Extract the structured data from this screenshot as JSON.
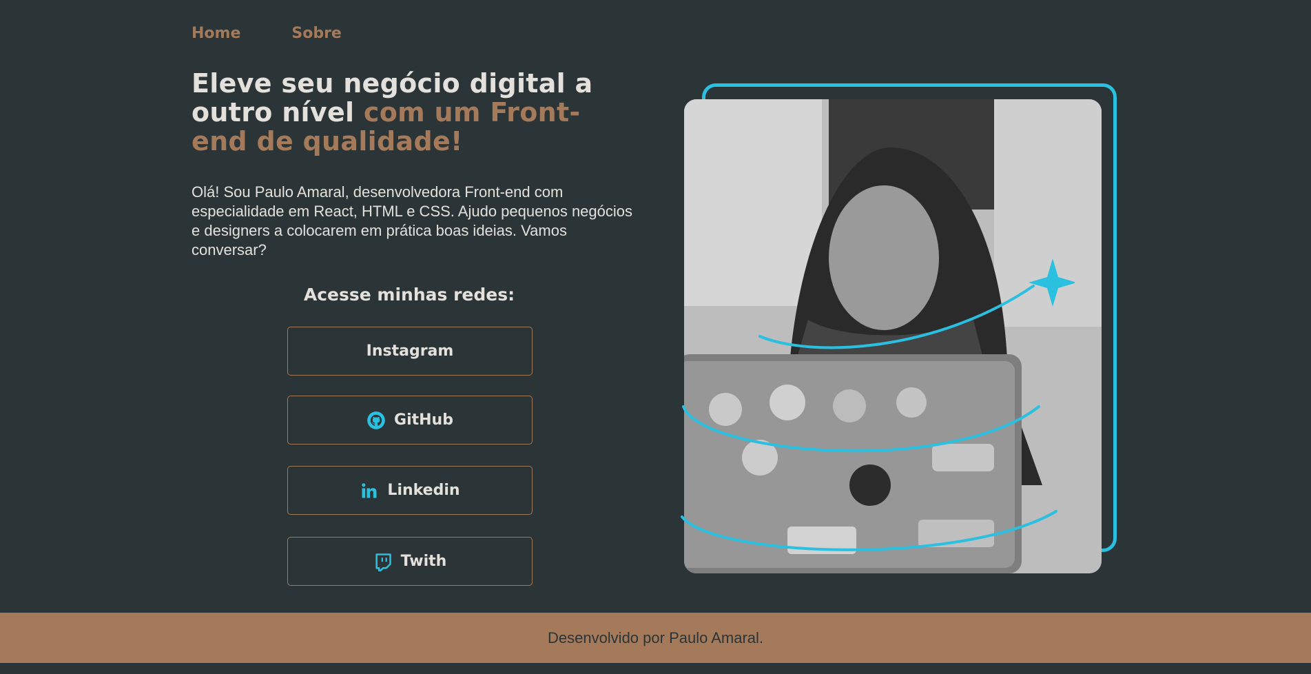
{
  "nav": {
    "items": [
      {
        "label": "Home"
      },
      {
        "label": "Sobre"
      }
    ]
  },
  "hero": {
    "headline_part1": "Eleve seu negócio digital a outro nível ",
    "headline_accent": "com um Front-end de qualidade!",
    "intro": "Olá! Sou Paulo Amaral, desenvolvedora Front-end com especialidade em React, HTML e CSS. Ajudo pequenos negócios e designers a colocarem em prática boas ideias. Vamos conversar?"
  },
  "social": {
    "title": "Acesse minhas redes:",
    "buttons": [
      {
        "label": "Instagram",
        "icon": "none"
      },
      {
        "label": "GitHub",
        "icon": "github-icon"
      },
      {
        "label": "Linkedin",
        "icon": "linkedin-icon"
      },
      {
        "label": "Twith",
        "icon": "twitch-icon"
      }
    ]
  },
  "footer": {
    "text": "Desenvolvido por Paulo Amaral."
  },
  "colors": {
    "background": "#2b3436",
    "accent": "#a57a5a",
    "text": "#e4e1dc",
    "highlight": "#2bbfe0"
  }
}
